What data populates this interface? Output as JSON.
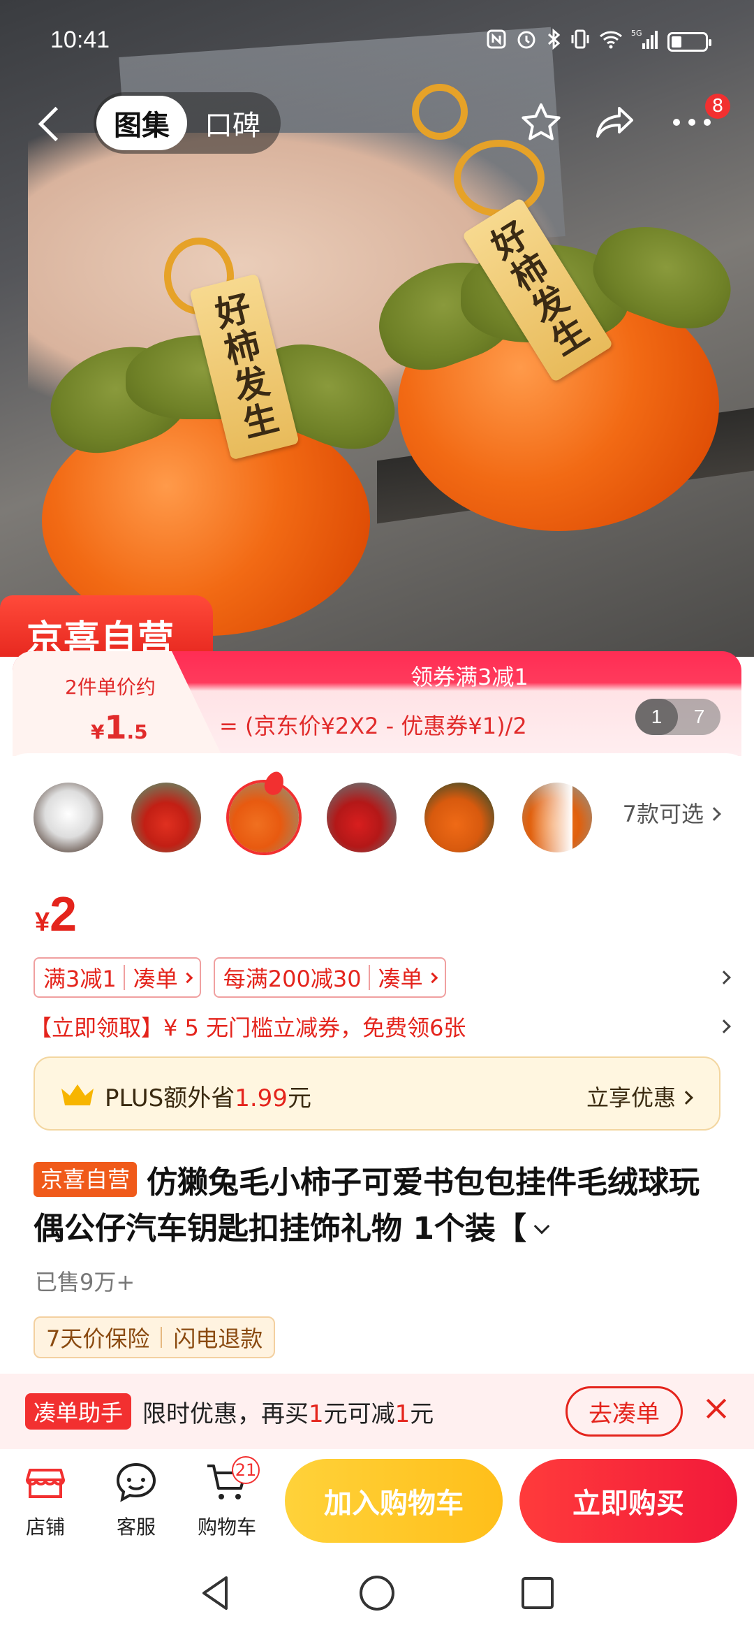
{
  "status_bar": {
    "time": "10:41",
    "icons": [
      "nfc-icon",
      "alarm-icon",
      "bluetooth-icon",
      "vibrate-icon",
      "wifi-icon",
      "signal-5g-icon",
      "battery-icon"
    ]
  },
  "hero": {
    "tag_text": "好柿发生",
    "store_badge": "京喜自营"
  },
  "top_nav": {
    "tabs": [
      {
        "label": "图集",
        "active": true
      },
      {
        "label": "口碑",
        "active": false
      }
    ],
    "more_badge": "8"
  },
  "promo": {
    "unit_label": "2件单价约",
    "unit_price_currency": "¥",
    "unit_price_int": "1",
    "unit_price_dec": ".5",
    "headline": "领券满3减1",
    "formula": "= (京东价¥2X2 - 优惠券¥1)/2",
    "pager_current": "1",
    "pager_total": "7"
  },
  "variants": {
    "count_text": "7款可选",
    "thumbnails": [
      "variant-1",
      "variant-2",
      "variant-3",
      "variant-4",
      "variant-5",
      "variant-6"
    ],
    "selected_index": 2
  },
  "price": {
    "currency": "¥",
    "value": "2"
  },
  "coupon_tags": [
    {
      "text": "满3减1",
      "action": "凑单"
    },
    {
      "text": "每满200减30",
      "action": "凑单"
    }
  ],
  "coupon_line": "【立即领取】¥ 5  无门槛立减券，免费领6张",
  "plus": {
    "prefix": "PLUS额外省",
    "amount": "1.99",
    "suffix": "元",
    "action": "立享优惠"
  },
  "product": {
    "badge": "京喜自营",
    "title": "仿獭兔毛小柿子可爱书包包挂件毛绒球玩偶公仔汽车钥匙扣挂饰礼物 1个装【",
    "sold": "已售9万+",
    "guarantees": [
      "7天价保险",
      "闪电退款"
    ]
  },
  "helper": {
    "label": "凑单助手",
    "msg_a": "限时优惠，再买",
    "msg_b": "1",
    "msg_c": "元可减",
    "msg_d": "1",
    "msg_e": "元",
    "button": "去凑单"
  },
  "bottom_bar": {
    "store": "店铺",
    "service": "客服",
    "cart": "购物车",
    "cart_count": "21",
    "add_to_cart": "加入购物车",
    "buy_now": "立即购买"
  },
  "colors": {
    "accent": "#f23030",
    "gold": "#ffc62a",
    "orange": "#f05a1a"
  }
}
